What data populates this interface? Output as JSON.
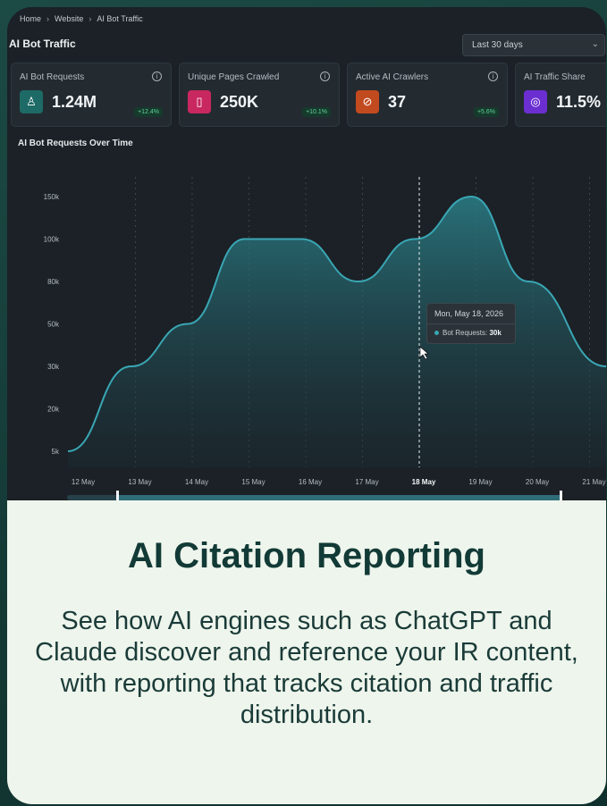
{
  "breadcrumb": [
    "Home",
    "Website",
    "AI Bot Traffic"
  ],
  "page_title": "AI Bot Traffic",
  "date_range": {
    "selected": "Last 30 days"
  },
  "kpis": [
    {
      "label": "AI Bot Requests",
      "value": "1.24M",
      "delta": "+12.4%",
      "icon": "robot-icon",
      "color": "#1e6a66"
    },
    {
      "label": "Unique Pages Crawled",
      "value": "250K",
      "delta": "+10.1%",
      "icon": "page-icon",
      "color": "#c8275f"
    },
    {
      "label": "Active AI Crawlers",
      "value": "37",
      "delta": "+5.6%",
      "icon": "crawler-icon",
      "color": "#c24a1f"
    },
    {
      "label": "AI Traffic Share",
      "value": "11.5%",
      "delta": "",
      "icon": "share-icon",
      "color": "#6b2fd1"
    }
  ],
  "chart_title": "AI Bot Requests Over Time",
  "chart_data": {
    "type": "area",
    "x": [
      "12 May",
      "13 May",
      "14 May",
      "15 May",
      "16 May",
      "17 May",
      "18 May",
      "19 May",
      "20 May",
      "21 May"
    ],
    "y_ticks": [
      "5k",
      "20k",
      "30k",
      "50k",
      "80k",
      "100k",
      "150k"
    ],
    "highlight_x": "18 May",
    "series": [
      {
        "values": [
          "5k",
          "30k",
          "50k",
          "100k",
          "100k",
          "80k",
          "100k",
          "150k",
          "80k",
          "30k"
        ]
      }
    ]
  },
  "tooltip": {
    "date": "Mon, May 18, 2026",
    "series_label": "Bot Requests:",
    "value": "30k"
  },
  "info": {
    "title": "AI Citation Reporting",
    "description": "See how AI engines such as ChatGPT and Claude discover and reference your IR content, with reporting that tracks citation and traffic distribution."
  },
  "colors": {
    "accent": "#3aa6b4",
    "background_dark": "#1b2126",
    "info_band": "#eef5ec",
    "title_green": "#123a36"
  }
}
